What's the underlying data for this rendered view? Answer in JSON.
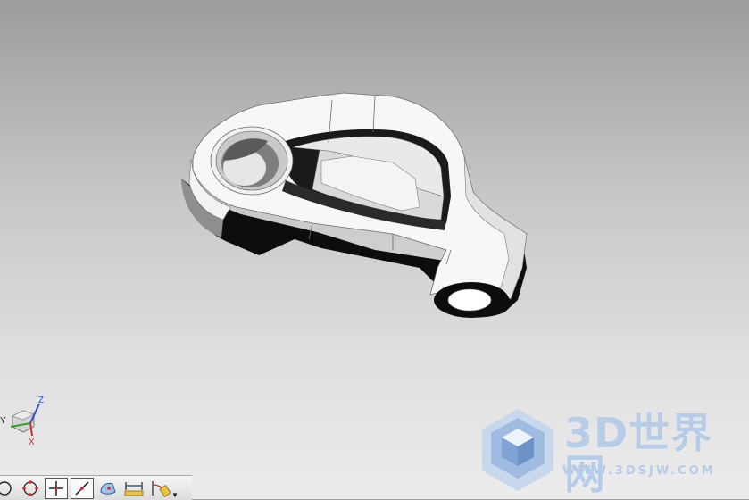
{
  "viewport": {
    "model": "rocker-arm-part",
    "triad": {
      "x": "X",
      "y": "Y",
      "z": "Z"
    }
  },
  "watermark": {
    "title": "3D世界网",
    "url": "WWW.3DSJW.COM",
    "color": "#b7cce6"
  },
  "toolbar": {
    "buttons": [
      {
        "icon": "circle-snap-icon"
      },
      {
        "icon": "quadrant-point-icon"
      },
      {
        "icon": "crosshair-point-icon"
      },
      {
        "icon": "line-point-icon"
      },
      {
        "icon": "face-point-icon"
      },
      {
        "icon": "distance-icon"
      },
      {
        "icon": "angle-icon"
      },
      {
        "icon": "dropdown-arrow-icon"
      }
    ]
  }
}
